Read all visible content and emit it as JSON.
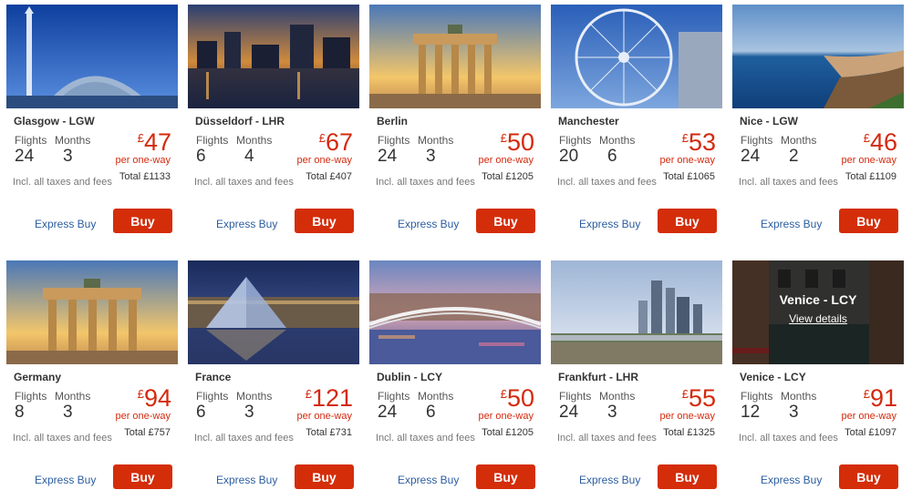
{
  "common": {
    "flights_label": "Flights",
    "months_label": "Months",
    "per_label": "per one-way",
    "tax_text": "Incl. all taxes and fees",
    "express_label": "Express Buy",
    "buy_label": "Buy",
    "currency": "£",
    "total_prefix": "Total £",
    "accent": "#d42d0a",
    "link_color": "#2b5d9f"
  },
  "cards": [
    {
      "dest": "Glasgow - LGW",
      "flights": "24",
      "months": "3",
      "price": "47",
      "total": "1133",
      "image": "glasgow-tower-image"
    },
    {
      "dest": "Düsseldorf - LHR",
      "flights": "6",
      "months": "4",
      "price": "67",
      "total": "407",
      "image": "dusseldorf-harbour-image"
    },
    {
      "dest": "Berlin",
      "flights": "24",
      "months": "3",
      "price": "50",
      "total": "1205",
      "image": "brandenburg-gate-image"
    },
    {
      "dest": "Manchester",
      "flights": "20",
      "months": "6",
      "price": "53",
      "total": "1065",
      "image": "manchester-wheel-image"
    },
    {
      "dest": "Nice - LGW",
      "flights": "24",
      "months": "2",
      "price": "46",
      "total": "1109",
      "image": "nice-coast-image"
    },
    {
      "dest": "Germany",
      "flights": "8",
      "months": "3",
      "price": "94",
      "total": "757",
      "image": "brandenburg-gate-image"
    },
    {
      "dest": "France",
      "flights": "6",
      "months": "3",
      "price": "121",
      "total": "731",
      "image": "louvre-pyramid-image"
    },
    {
      "dest": "Dublin - LCY",
      "flights": "24",
      "months": "6",
      "price": "50",
      "total": "1205",
      "image": "halfpenny-bridge-image"
    },
    {
      "dest": "Frankfurt - LHR",
      "flights": "24",
      "months": "3",
      "price": "55",
      "total": "1325",
      "image": "frankfurt-skyline-image"
    },
    {
      "dest": "Venice - LCY",
      "flights": "12",
      "months": "3",
      "price": "91",
      "total": "1097",
      "image": "venice-canal-image",
      "overlay_title": "Venice - LCY",
      "overlay_link": "View details"
    }
  ]
}
